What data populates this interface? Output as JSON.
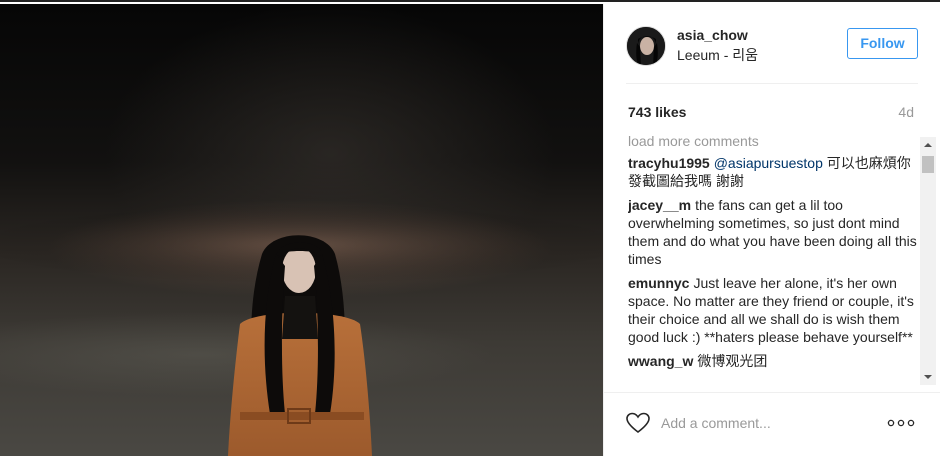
{
  "post": {
    "username": "asia_chow",
    "location": "Leeum - 리움",
    "follow_label": "Follow",
    "likes": "743 likes",
    "age": "4d"
  },
  "comments": {
    "load_more": "load more comments",
    "items": [
      {
        "author": "tracyhu1995",
        "mention": "@asiapursuestop",
        "text": " 可以也麻煩你發截圖給我嗎 謝謝"
      },
      {
        "author": "jacey__m",
        "mention": "",
        "text": "the fans can get a lil too overwhelming sometimes, so just dont mind them and do what you have been doing all this times"
      },
      {
        "author": "emunnyc",
        "mention": "",
        "text": "Just leave her alone, it's her own space. No matter are they friend or couple, it's their choice and all we shall do is wish them good luck :) **haters please behave yourself**"
      },
      {
        "author": "wwang_w",
        "mention": "",
        "text": "微博观光团"
      }
    ]
  },
  "composer": {
    "placeholder": "Add a comment..."
  },
  "icons": {
    "heart": "heart-icon",
    "more": "more-options-icon",
    "avatar": "avatar"
  },
  "colors": {
    "accent": "#3897f0",
    "mention": "#003569",
    "muted": "#999999"
  }
}
